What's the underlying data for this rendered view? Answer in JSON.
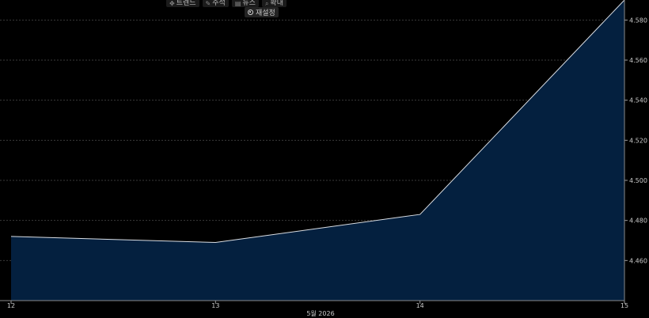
{
  "toolbar": {
    "items": [
      {
        "label": "트렌드",
        "icon": "move-icon"
      },
      {
        "label": "주석",
        "icon": "pencil-icon"
      },
      {
        "label": "뉴스",
        "icon": "news-icon"
      },
      {
        "label": "확대",
        "icon": "zoom-icon"
      }
    ],
    "reset_label": "재설정"
  },
  "chart_data": {
    "type": "area",
    "x": [
      "12",
      "13",
      "14",
      "15"
    ],
    "values": [
      4.472,
      4.469,
      4.483,
      4.59
    ],
    "xlabel": "5월 2026",
    "ylabel": "",
    "ylim": [
      4.44,
      4.59
    ],
    "yticks": [
      "4.460",
      "4.480",
      "4.500",
      "4.520",
      "4.540",
      "4.560",
      "4.580"
    ],
    "grid": true,
    "colors": {
      "fill": "#04203f",
      "line": "#d9dde3",
      "grid": "#3a3a3a"
    }
  }
}
